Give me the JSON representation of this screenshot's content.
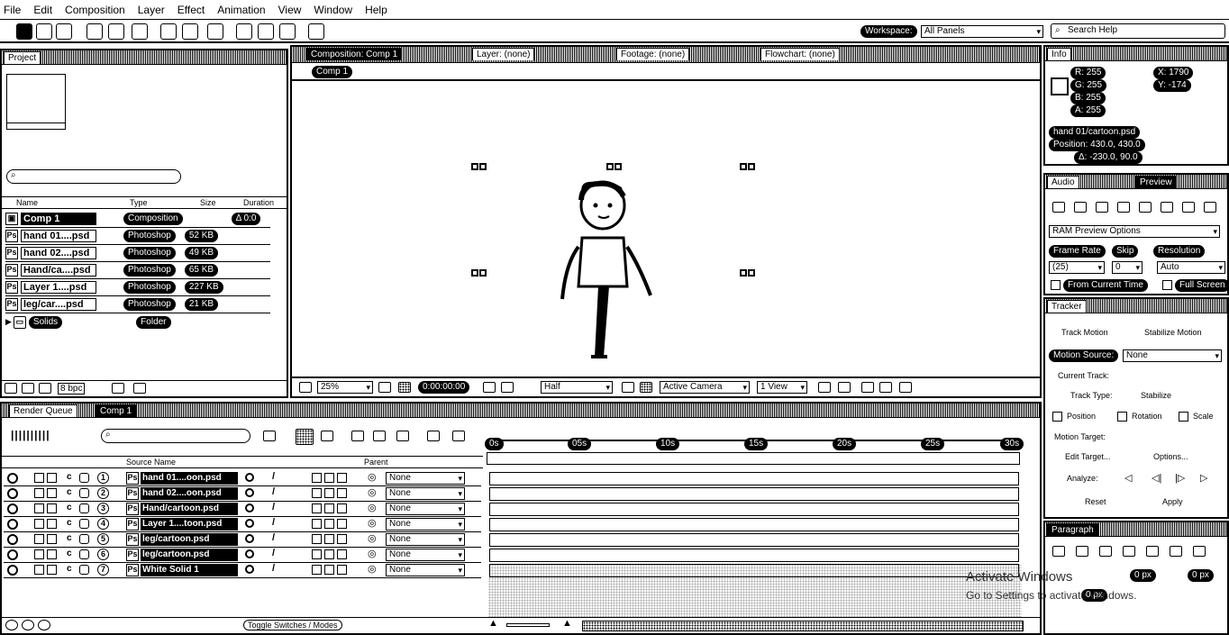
{
  "menu": [
    "File",
    "Edit",
    "Composition",
    "Layer",
    "Effect",
    "Animation",
    "View",
    "Window",
    "Help"
  ],
  "toolbar": {
    "workspace_label": "Workspace:",
    "workspace_value": "All Panels",
    "search_placeholder": "Search Help"
  },
  "project": {
    "tab": "Project",
    "search_placeholder": "",
    "columns": [
      "Name",
      "Type",
      "Size",
      "Duration"
    ],
    "items": [
      {
        "name": "Comp 1",
        "type": "Composition",
        "size": "",
        "duration": "Δ 0:0"
      },
      {
        "name": "hand 01....psd",
        "type": "Photoshop",
        "size": "52 KB",
        "duration": ""
      },
      {
        "name": "hand 02....psd",
        "type": "Photoshop",
        "size": "49 KB",
        "duration": ""
      },
      {
        "name": "Hand/ca....psd",
        "type": "Photoshop",
        "size": "65 KB",
        "duration": ""
      },
      {
        "name": "Layer 1....psd",
        "type": "Photoshop",
        "size": "227 KB",
        "duration": ""
      },
      {
        "name": "leg/car....psd",
        "type": "Photoshop",
        "size": "21 KB",
        "duration": ""
      },
      {
        "name": "Solids",
        "type": "Folder",
        "size": "",
        "duration": ""
      }
    ],
    "bpc": "8 bpc"
  },
  "composition": {
    "tab": "Composition: Comp 1",
    "subtab": "Comp 1",
    "other_tabs": [
      "Layer: (none)",
      "Footage: (none)",
      "Flowchart: (none)"
    ],
    "footer": {
      "zoom": "25%",
      "time": "0:00:00:00",
      "resolution": "Half",
      "camera": "Active Camera",
      "view": "1 View"
    }
  },
  "info": {
    "tab": "Info",
    "r": "R: 255",
    "g": "G: 255",
    "b": "B: 255",
    "a": "A: 255",
    "x": "X: 1790",
    "y": "Y: -174",
    "layer": "hand 01/cartoon.psd",
    "position": "Position: 430.0, 430.0",
    "delta": "Δ: -230.0, 90.0"
  },
  "preview": {
    "tabs": [
      "Audio",
      "Preview"
    ],
    "ram_options": "RAM Preview Options",
    "frame_rate_label": "Frame Rate",
    "skip_label": "Skip",
    "resolution_label": "Resolution",
    "frame_rate": "(25)",
    "skip": "0",
    "resolution": "Auto",
    "from_current": "From Current Time",
    "full_screen": "Full Screen"
  },
  "tracker": {
    "tab": "Tracker",
    "buttons": [
      "Track Motion",
      "Stabilize Motion"
    ],
    "motion_source_label": "Motion Source:",
    "motion_source": "None",
    "current_track_label": "Current Track:",
    "track_type_label": "Track Type:",
    "track_type": "Stabilize",
    "options": [
      "Position",
      "Rotation",
      "Scale"
    ],
    "motion_target": "Motion Target:",
    "edit_target": "Edit Target...",
    "options_btn": "Options...",
    "analyze_label": "Analyze:",
    "reset": "Reset",
    "apply": "Apply"
  },
  "paragraph": {
    "tab": "Paragraph",
    "px_values": [
      "0 px",
      "0 px",
      "0 px"
    ]
  },
  "timeline": {
    "tabs": [
      "Render Queue",
      "Comp 1"
    ],
    "search_placeholder": "",
    "columns": {
      "source_name": "Source Name",
      "parent": "Parent"
    },
    "ruler": [
      "0s",
      "05s",
      "10s",
      "15s",
      "20s",
      "25s",
      "30s"
    ],
    "layers": [
      {
        "num": "1",
        "name": "hand 01....oon.psd",
        "parent": "None"
      },
      {
        "num": "2",
        "name": "hand 02....oon.psd",
        "parent": "None"
      },
      {
        "num": "3",
        "name": "Hand/cartoon.psd",
        "parent": "None"
      },
      {
        "num": "4",
        "name": "Layer 1....toon.psd",
        "parent": "None"
      },
      {
        "num": "5",
        "name": "leg/cartoon.psd",
        "parent": "None"
      },
      {
        "num": "6",
        "name": "leg/cartoon.psd",
        "parent": "None"
      },
      {
        "num": "7",
        "name": "White Solid 1",
        "parent": "None"
      }
    ],
    "toggle": "Toggle Switches / Modes"
  },
  "watermark": {
    "line1": "Activate Windows",
    "line2": "Go to Settings to activate Windows."
  }
}
